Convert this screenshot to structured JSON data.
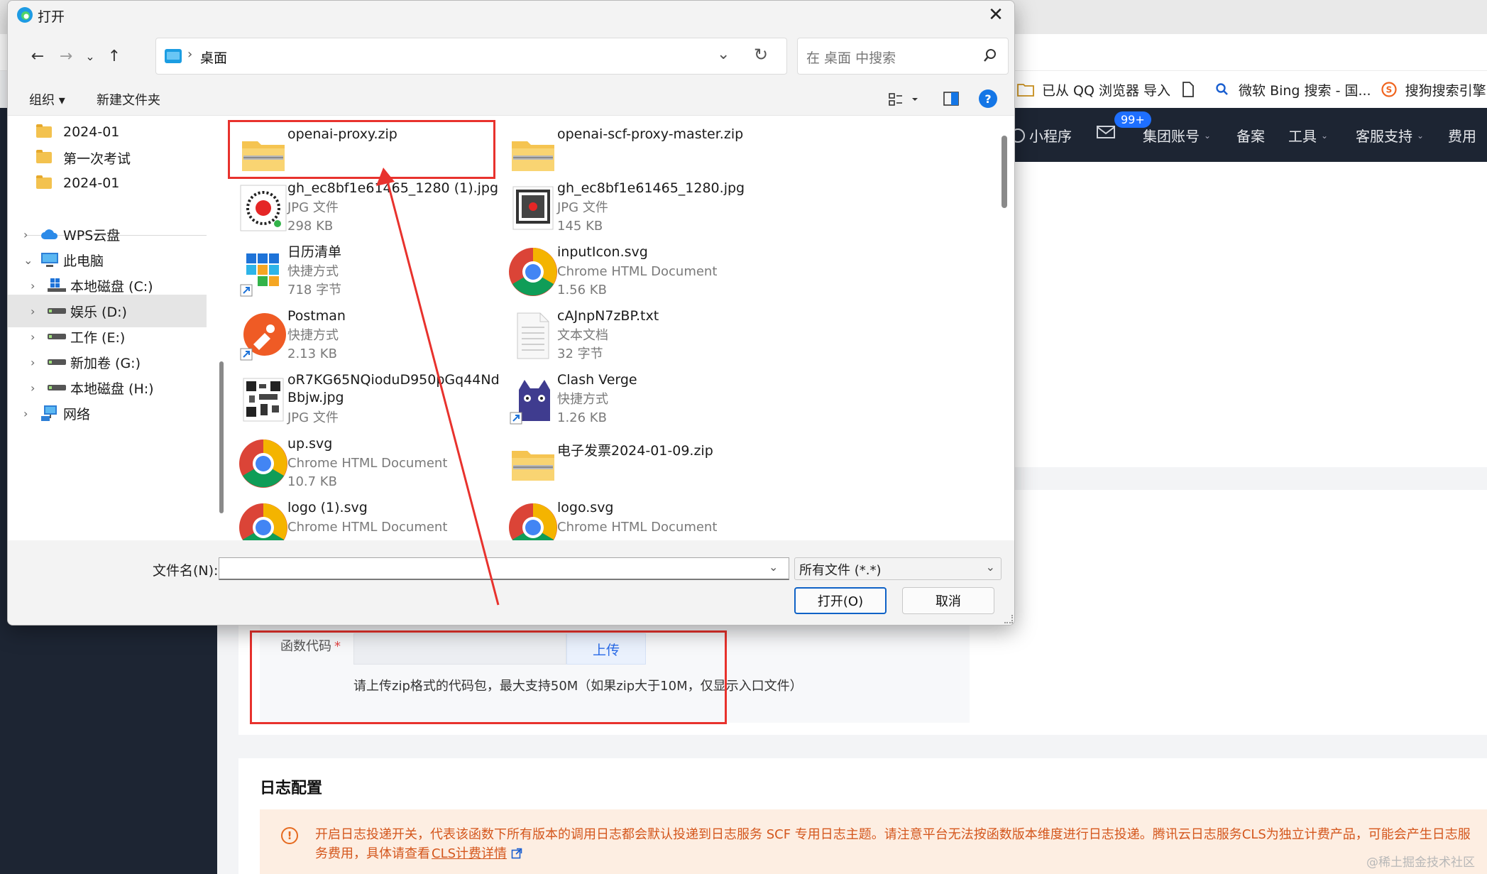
{
  "background": {
    "bookmarks": [
      {
        "label": "已从 QQ 浏览器 导入",
        "icon": "folder-icon"
      },
      {
        "label": "",
        "icon": "document-icon"
      },
      {
        "label": "微软 Bing 搜索 - 国...",
        "icon": "bing-search-icon"
      },
      {
        "label": "搜狗搜索引擎 -",
        "icon": "sogou-icon"
      }
    ],
    "nav": {
      "mini_program": "小程序",
      "badge": "99+",
      "group_account": "集团账号",
      "filing": "备案",
      "tools": "工具",
      "support": "客服支持",
      "billing": "费用"
    },
    "function_code": {
      "label": "函数代码",
      "required_mark": "*",
      "upload_button": "上传",
      "hint": "请上传zip格式的代码包，最大支持50M（如果zip大于10M，仅显示入口文件）"
    },
    "log_config": {
      "title": "日志配置",
      "notice_icon": "!",
      "notice": "开启日志投递开关，代表该函数下所有版本的调用日志都会默认投递到日志服务 SCF 专用日志主题。请注意平台无法按函数版本维度进行日志投递。腾讯云日志服务CLS为独立计费产品，可能会产生日志服务费用，具体请查看",
      "notice_link": "CLS计费详情"
    },
    "watermark": "@稀土掘金技术社区"
  },
  "dialog": {
    "title": "打开",
    "address": {
      "sep": "›",
      "location": "桌面"
    },
    "search_placeholder": "在 桌面 中搜索",
    "toolbar": {
      "organize": "组织 ▾",
      "new_folder": "新建文件夹",
      "help": "?"
    },
    "nav_pane": {
      "items": [
        {
          "label": "2024-01",
          "icon": "folder-icon",
          "chevron": ""
        },
        {
          "label": "第一次考试",
          "icon": "folder-icon",
          "chevron": ""
        },
        {
          "label": "2024-01",
          "icon": "folder-icon",
          "chevron": ""
        },
        {
          "label": "WPS云盘",
          "icon": "cloud-icon",
          "chevron": "›"
        },
        {
          "label": "此电脑",
          "icon": "computer-icon",
          "chevron": "⌄"
        },
        {
          "label": "本地磁盘 (C:)",
          "icon": "windows-drive-icon",
          "chevron": "›"
        },
        {
          "label": "娱乐 (D:)",
          "icon": "drive-icon",
          "chevron": "›",
          "selected": true
        },
        {
          "label": "工作 (E:)",
          "icon": "drive-icon",
          "chevron": "›"
        },
        {
          "label": "新加卷 (G:)",
          "icon": "drive-icon",
          "chevron": "›"
        },
        {
          "label": "本地磁盘 (H:)",
          "icon": "drive-icon",
          "chevron": "›"
        },
        {
          "label": "网络",
          "icon": "network-icon",
          "chevron": "›"
        }
      ]
    },
    "files": [
      {
        "name": "openai-proxy.zip",
        "type": "",
        "size": "",
        "icon": "zip-folder-icon"
      },
      {
        "name": "openai-scf-proxy-master.zip",
        "type": "",
        "size": "",
        "icon": "zip-folder-icon"
      },
      {
        "name": "gh_ec8bf1e61465_1280 (1).jpg",
        "type": "JPG 文件",
        "size": "298 KB",
        "icon": "qr-image-icon"
      },
      {
        "name": "gh_ec8bf1e61465_1280.jpg",
        "type": "JPG 文件",
        "size": "145 KB",
        "icon": "qr-image-icon"
      },
      {
        "name": "日历清单",
        "type": "快捷方式",
        "size": "718 字节",
        "icon": "calendar-app-icon"
      },
      {
        "name": "inputIcon.svg",
        "type": "Chrome HTML Document",
        "size": "1.56 KB",
        "icon": "chrome-icon"
      },
      {
        "name": "Postman",
        "type": "快捷方式",
        "size": "2.13 KB",
        "icon": "postman-icon"
      },
      {
        "name": "cAJnpN7zBP.txt",
        "type": "文本文档",
        "size": "32 字节",
        "icon": "text-file-icon"
      },
      {
        "name": "oR7KG65NQioduD950pGq44NdBbjw.jpg",
        "type": "JPG 文件",
        "size": "",
        "icon": "qr-image-icon"
      },
      {
        "name": "Clash Verge",
        "type": "快捷方式",
        "size": "1.26 KB",
        "icon": "clash-cat-icon"
      },
      {
        "name": "up.svg",
        "type": "Chrome HTML Document",
        "size": "10.7 KB",
        "icon": "chrome-icon"
      },
      {
        "name": "电子发票2024-01-09.zip",
        "type": "",
        "size": "",
        "icon": "zip-folder-icon"
      },
      {
        "name": "logo (1).svg",
        "type": "Chrome HTML Document",
        "size": "",
        "icon": "chrome-icon"
      },
      {
        "name": "logo.svg",
        "type": "Chrome HTML Document",
        "size": "",
        "icon": "chrome-icon"
      }
    ],
    "filename_label": "文件名(N):",
    "filename_value": "",
    "filter": "所有文件 (*.*)",
    "open_button": "打开(O)",
    "cancel_button": "取消"
  },
  "colors": {
    "annotation_red": "#e8322d",
    "accent_blue": "#0f62c6",
    "nav_dark": "#1d2533"
  }
}
